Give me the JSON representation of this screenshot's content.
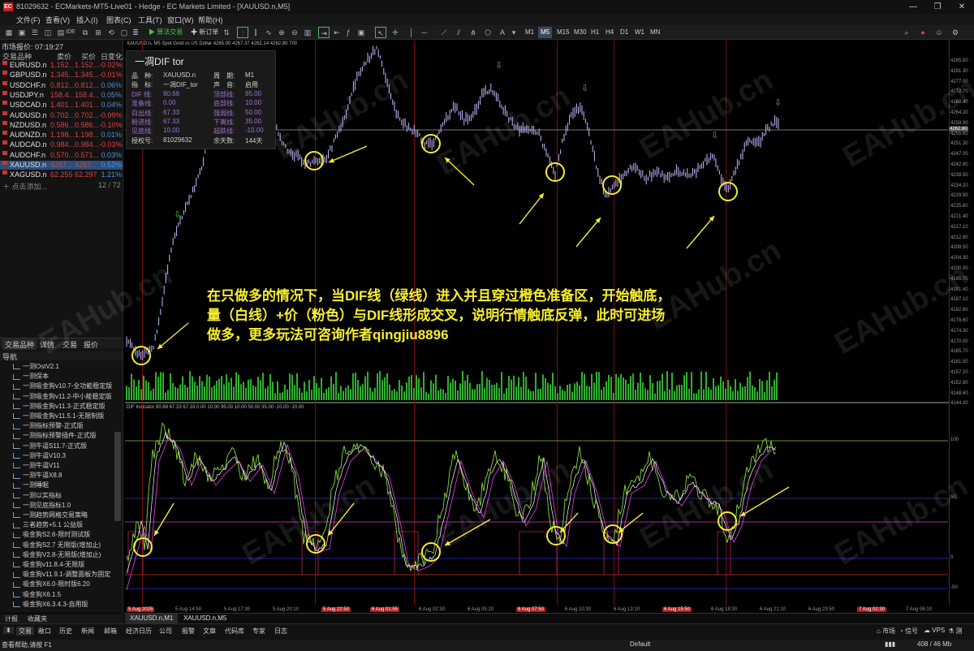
{
  "window": {
    "title": "81029632 - ECMarkets-MT5-Live01 - Hedge - EC Markets Limited - [XAUUSD.n,M5]",
    "logo": "EC",
    "controls": [
      "—",
      "❐",
      "✕"
    ]
  },
  "menu": [
    "文件(F)",
    "查看(V)",
    "插入(I)",
    "图表(C)",
    "工具(T)",
    "窗口(W)",
    "帮助(H)"
  ],
  "toolbar": {
    "algo_label": "算法交易",
    "new_order_label": "新订单",
    "timeframes": [
      "M1",
      "M5",
      "M15",
      "M30",
      "H1",
      "H4",
      "D1",
      "W1",
      "MN"
    ],
    "active_timeframe": "M5"
  },
  "market_watch": {
    "header": "市场报价: 07:19:27",
    "columns": [
      "交易品种",
      "卖价",
      "买价",
      "日变化"
    ],
    "rows": [
      {
        "symbol": "EURUSD.n",
        "bid": "1.152...",
        "ask": "1.152...",
        "change": "-0.02%",
        "dir": "neg"
      },
      {
        "symbol": "GBPUSD.n",
        "bid": "1.345...",
        "ask": "1.345...",
        "change": "-0.01%",
        "dir": "neg"
      },
      {
        "symbol": "USDCHF.n",
        "bid": "0.812...",
        "ask": "0.812...",
        "change": "0.06%",
        "dir": "pos"
      },
      {
        "symbol": "USDJPY.n",
        "bid": "158.4...",
        "ask": "158.4...",
        "change": "0.05%",
        "dir": "pos"
      },
      {
        "symbol": "USDCAD.n",
        "bid": "1.401...",
        "ask": "1.401...",
        "change": "0.04%",
        "dir": "pos"
      },
      {
        "symbol": "AUDUSD.n",
        "bid": "0.702...",
        "ask": "0.702...",
        "change": "-0.09%",
        "dir": "neg"
      },
      {
        "symbol": "NZDUSD.n",
        "bid": "0.586...",
        "ask": "0.586...",
        "change": "-0.10%",
        "dir": "neg"
      },
      {
        "symbol": "AUDNZD.n",
        "bid": "1.198...",
        "ask": "1.198...",
        "change": "0.01%",
        "dir": "pos"
      },
      {
        "symbol": "AUDCAD.n",
        "bid": "0.984...",
        "ask": "0.984...",
        "change": "-0.03%",
        "dir": "neg"
      },
      {
        "symbol": "AUDCHF.n",
        "bid": "0.570...",
        "ask": "0.571...",
        "change": "0.03%",
        "dir": "pos"
      },
      {
        "symbol": "XAUUSD.n",
        "bid": "4267...",
        "ask": "4267...",
        "change": "0.52%",
        "dir": "pos",
        "selected": true
      },
      {
        "symbol": "XAGUSD.n",
        "bid": "62.255",
        "ask": "62.297",
        "change": "1.21%",
        "dir": "pos"
      }
    ],
    "add_label": "点击添加...",
    "count": "12 / 72",
    "tabs": [
      "交易品种",
      "详情",
      "交易",
      "报价"
    ]
  },
  "navigator": {
    "title": "导航",
    "items": [
      "一测OstV2.1",
      "一测保本",
      "一测吸金狗v10.7-全功能稳定版",
      "一测吸金狗v11.2-中小能稳定版",
      "一测吸金狗v11.3-正式稳定版",
      "一测吸金狗v11.5.1-无限制版",
      "一测指标预警-正式版",
      "一测指标预警插件-正式版",
      "一测牛逼S11.7-正式版",
      "一测牛逼V10.3",
      "一测牛逼V11",
      "一测牛逼X8.8",
      "一测睡眠",
      "一测以实指标",
      "一测见底指标1.0",
      "一测趋势网格交易策略",
      "三者趋势+5.1 公益版",
      "吸金狗S2.6-限时测试版",
      "吸金狗S2.7 无限版(增加止)",
      "吸金狗V2.8-无限版(增加止)",
      "吸金狗v11.8.4-无限版",
      "吸金狗v11.9.1-调整面板为固定",
      "吸金狗X6.0-限时版6.20",
      "吸金狗X6.1.5",
      "吸金狗X6.3.4.3-自用版"
    ]
  },
  "chart": {
    "header": "XAUUSD.n, M5   Spot Gold vs US Dollar  4265.00 4267.37 4262.14 4262.80  700",
    "indicator_header": "DIF Indicator 80.68 67.33 67.33 0.00 10.00 95.00 10.00 50.00 35.00 -10.00 -10.00",
    "price_labels": [
      "4285.50",
      "4281.30",
      "4277.00",
      "4272.70",
      "4268.40",
      "4264.20",
      "4259.90",
      "4255.60",
      "4251.30",
      "4247.00",
      "4242.80",
      "4238.50",
      "4234.20",
      "4229.90",
      "4225.60",
      "4221.40",
      "4217.10",
      "4212.80",
      "4208.50",
      "4204.30",
      "4200.00",
      "4195.70",
      "4191.40",
      "4187.10",
      "4182.80",
      "4178.60",
      "4174.30",
      "4170.00",
      "4165.70",
      "4161.50",
      "4157.20",
      "4152.90",
      "4148.60",
      "4144.30"
    ],
    "current_price": "4262.80",
    "ind_labels": [
      "100",
      "50",
      "0",
      "-50"
    ],
    "time_labels": [
      {
        "t": "5 Aug 2025",
        "red": true
      },
      {
        "t": "5 Aug 14:50",
        "red": false
      },
      {
        "t": "5 Aug 17:30",
        "red": false
      },
      {
        "t": "5 Aug 20:10",
        "red": false
      },
      {
        "t": "5 Aug 22:50",
        "red": true
      },
      {
        "t": "6 Aug 01:55",
        "red": true
      },
      {
        "t": "6 Aug 02:30",
        "red": false
      },
      {
        "t": "6 Aug 05:10",
        "red": false
      },
      {
        "t": "6 Aug 07:50",
        "red": true
      },
      {
        "t": "6 Aug 10:30",
        "red": false
      },
      {
        "t": "6 Aug 13:10",
        "red": false
      },
      {
        "t": "6 Aug 15:50",
        "red": true
      },
      {
        "t": "6 Aug 18:30",
        "red": false
      },
      {
        "t": "6 Aug 21:10",
        "red": false
      },
      {
        "t": "6 Aug 23:50",
        "red": false
      },
      {
        "t": "7 Aug 02:30",
        "red": true
      },
      {
        "t": "7 Aug 06:10",
        "red": false
      }
    ]
  },
  "dif_panel": {
    "title": "一凋DIF tor",
    "rows": [
      {
        "l1": "品　种:",
        "v1": "XAUUSD.n",
        "l2": "周　期:",
        "v2": "M1",
        "purple": false
      },
      {
        "l1": "指　标:",
        "v1": "一凋DIF_tor",
        "l2": "声　音:",
        "v2": "启用",
        "purple": false
      },
      {
        "l1": "DIF 线:",
        "v1": "80.68",
        "l2": "顶部线:",
        "v2": "95.00",
        "purple": true
      },
      {
        "l1": "准备线:",
        "v1": "0.00",
        "l2": "底部线:",
        "v2": "10.00",
        "purple": true
      },
      {
        "l1": "白出线:",
        "v1": "67.33",
        "l2": "强弱线:",
        "v2": "50.00",
        "purple": true
      },
      {
        "l1": "粉进线:",
        "v1": "67.33",
        "l2": "下离线:",
        "v2": "35.00",
        "purple": true
      },
      {
        "l1": "见底线:",
        "v1": "10.00",
        "l2": "超跌线:",
        "v2": "-10.00",
        "purple": true
      },
      {
        "l1": "授权号:",
        "v1": "81029632",
        "l2": "余天数:",
        "v2": "144天",
        "purple": false
      }
    ]
  },
  "annotation": [
    "在只做多的情况下，当DIF线（绿线）进入并且穿过橙色准备区，开始触底，",
    "量（白线）+价（粉色）与DIF线形成交叉，说明行情触底反弹，此时可进场",
    "做多，更多玩法可咨询作者qingjiu8896"
  ],
  "watermark": "EAHub.cn",
  "chart_tabs": [
    "XAUUSD.n,M1",
    "XAUUSD.n,M5"
  ],
  "toolbox": {
    "left_tabs": [
      "计报",
      "收藏夹"
    ],
    "tabs": [
      "交易",
      "敞口",
      "历史",
      "新闻",
      "邮箱",
      "经济日历",
      "公司",
      "报警",
      "文章",
      "代码库",
      "专家",
      "日志"
    ],
    "right_items": [
      "市场",
      "信号",
      "VPS",
      "测"
    ]
  },
  "status": {
    "left": "查看帮助,请按 F1",
    "center": "Default",
    "right": "408 / 46 Mb"
  },
  "colors": {
    "price_bars": "#c8b6ff",
    "dif_line": "#86d93a",
    "pink_line": "#d33ad3",
    "white_line": "#ffffff",
    "volume": "#2db12d",
    "annotation": "#f6ee2f"
  }
}
